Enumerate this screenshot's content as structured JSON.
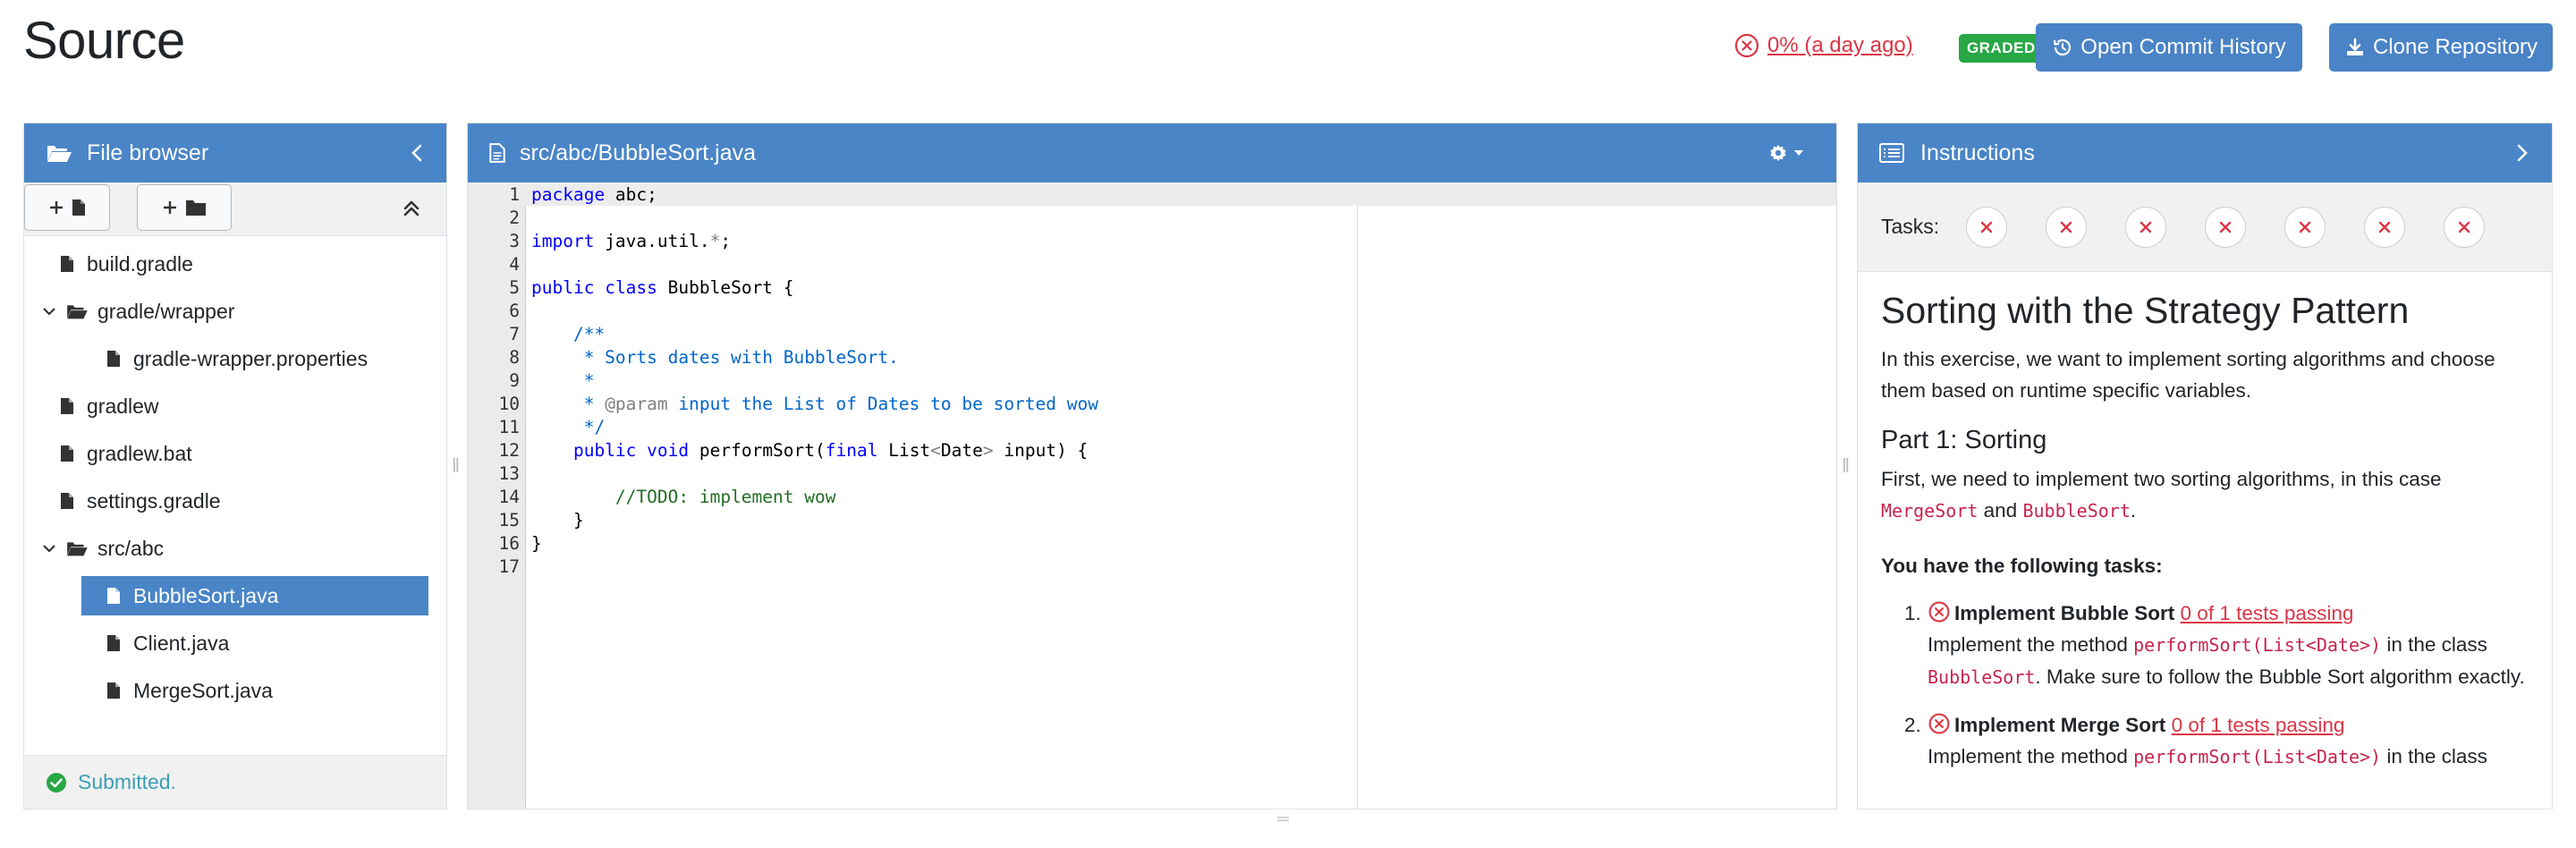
{
  "page": {
    "title": "Source"
  },
  "result": {
    "text": "0% (a day ago)",
    "badge": "GRADED"
  },
  "header_buttons": {
    "history_label": "Open Commit History",
    "clone_label": "Clone Repository"
  },
  "file_browser": {
    "title": "File browser",
    "status": "Submitted.",
    "items": [
      {
        "label": "build.gradle"
      },
      {
        "label": "gradle/wrapper"
      },
      {
        "label": "gradle-wrapper.properties"
      },
      {
        "label": "gradlew"
      },
      {
        "label": "gradlew.bat"
      },
      {
        "label": "settings.gradle"
      },
      {
        "label": "src/abc"
      },
      {
        "label": "BubbleSort.java"
      },
      {
        "label": "Client.java"
      },
      {
        "label": "MergeSort.java"
      }
    ]
  },
  "editor": {
    "file_path": "src/abc/BubbleSort.java",
    "lines": [
      {
        "n": "1",
        "text": "package abc;"
      },
      {
        "n": "2",
        "text": ""
      },
      {
        "n": "3",
        "text": "import java.util.*;"
      },
      {
        "n": "4",
        "text": ""
      },
      {
        "n": "5",
        "text": "public class BubbleSort {"
      },
      {
        "n": "6",
        "text": ""
      },
      {
        "n": "7",
        "text": "    /**"
      },
      {
        "n": "8",
        "text": "     * Sorts dates with BubbleSort."
      },
      {
        "n": "9",
        "text": "     *"
      },
      {
        "n": "10",
        "text": "     * @param input the List of Dates to be sorted wow"
      },
      {
        "n": "11",
        "text": "     */"
      },
      {
        "n": "12",
        "text": "    public void performSort(final List<Date> input) {"
      },
      {
        "n": "13",
        "text": ""
      },
      {
        "n": "14",
        "text": "        //TODO: implement wow"
      },
      {
        "n": "15",
        "text": "    }"
      },
      {
        "n": "16",
        "text": "}"
      },
      {
        "n": "17",
        "text": ""
      }
    ]
  },
  "instructions": {
    "title": "Instructions",
    "tasks_label": "Tasks:",
    "task_count": 7,
    "heading": "Sorting with the Strategy Pattern",
    "intro": "In this exercise, we want to implement sorting algorithms and choose them based on runtime specific variables.",
    "part1_title": "Part 1: Sorting",
    "part1_text_a": "First, we need to implement two sorting algorithms, in this case",
    "part1_code_a": "MergeSort",
    "part1_and": "and",
    "part1_code_b": "BubbleSort",
    "part1_dot": ".",
    "tasks_heading": "You have the following tasks:",
    "task1": {
      "num": "1.",
      "name": "Implement Bubble Sort",
      "status": "0 of 1 tests passing",
      "text_a": "Implement the method",
      "code_a": "performSort(List<Date>)",
      "text_b": "in the class",
      "code_b": "BubbleSort",
      "text_c": ". Make sure to follow the Bubble Sort algorithm exactly."
    },
    "task2": {
      "num": "2.",
      "name": "Implement Merge Sort",
      "status": "0 of 1 tests passing",
      "text_a": "Implement the method",
      "code_a": "performSort(List<Date>)",
      "text_b": "in the class"
    }
  }
}
